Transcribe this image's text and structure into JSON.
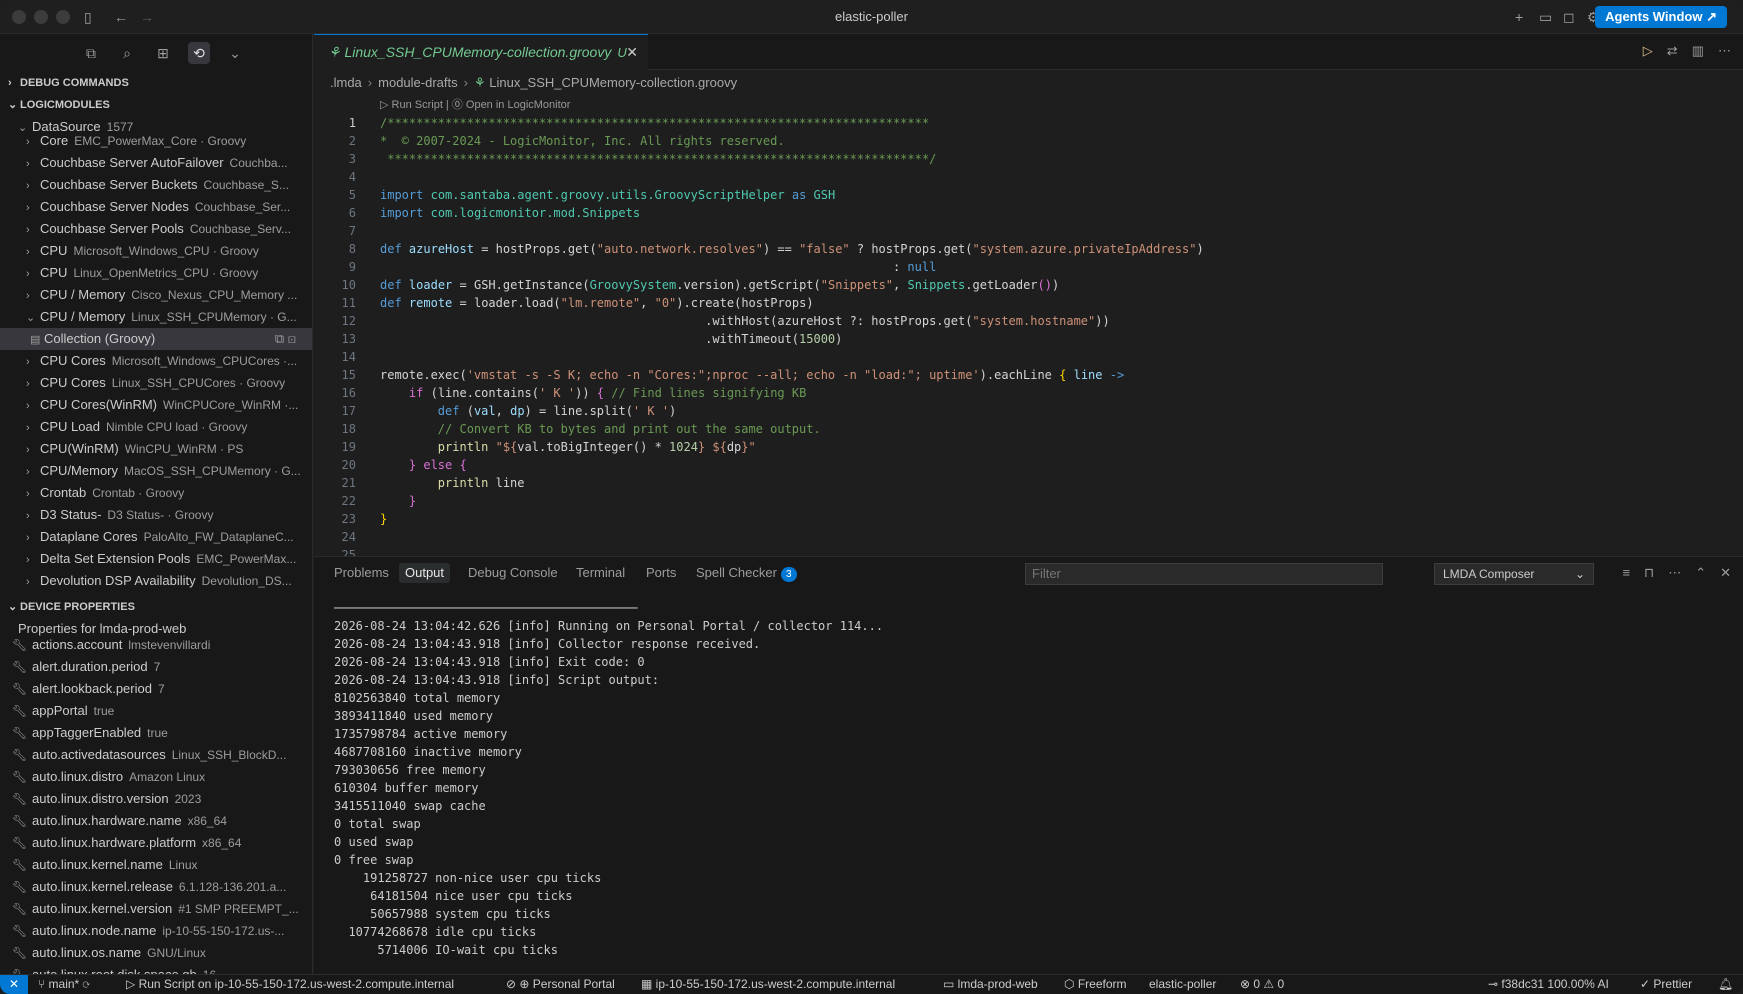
{
  "window": {
    "title": "elastic-poller",
    "agents_button": "Agents Window"
  },
  "sidebar": {
    "debug_commands": "DEBUG COMMANDS",
    "logicmodules": "LOGICMODULES",
    "datasource": {
      "label": "DataSource",
      "count": "1577"
    },
    "items": [
      {
        "label": "Core",
        "desc": "EMC_PowerMax_Core · Groovy",
        "expanded": false
      },
      {
        "label": "Couchbase Server AutoFailover",
        "desc": "Couchba...",
        "expanded": false
      },
      {
        "label": "Couchbase Server Buckets",
        "desc": "Couchbase_S...",
        "expanded": false
      },
      {
        "label": "Couchbase Server Nodes",
        "desc": "Couchbase_Ser...",
        "expanded": false
      },
      {
        "label": "Couchbase Server Pools",
        "desc": "Couchbase_Serv...",
        "expanded": false
      },
      {
        "label": "CPU",
        "desc": "Microsoft_Windows_CPU · Groovy",
        "expanded": false
      },
      {
        "label": "CPU",
        "desc": "Linux_OpenMetrics_CPU · Groovy",
        "expanded": false
      },
      {
        "label": "CPU / Memory",
        "desc": "Cisco_Nexus_CPU_Memory ...",
        "expanded": false
      },
      {
        "label": "CPU / Memory",
        "desc": "Linux_SSH_CPUMemory · G...",
        "expanded": true
      },
      {
        "label": "Collection (Groovy)",
        "desc": "",
        "child": true
      },
      {
        "label": "CPU Cores",
        "desc": "Microsoft_Windows_CPUCores ·...",
        "expanded": false
      },
      {
        "label": "CPU Cores",
        "desc": "Linux_SSH_CPUCores · Groovy",
        "expanded": false
      },
      {
        "label": "CPU Cores(WinRM)",
        "desc": "WinCPUCore_WinRM ·...",
        "expanded": false
      },
      {
        "label": "CPU Load",
        "desc": "Nimble CPU load · Groovy",
        "expanded": false
      },
      {
        "label": "CPU(WinRM)",
        "desc": "WinCPU_WinRM · PS",
        "expanded": false
      },
      {
        "label": "CPU/Memory",
        "desc": "MacOS_SSH_CPUMemory · G...",
        "expanded": false
      },
      {
        "label": "Crontab",
        "desc": "Crontab · Groovy",
        "expanded": false
      },
      {
        "label": "D3 Status-",
        "desc": "D3 Status- · Groovy",
        "expanded": false
      },
      {
        "label": "Dataplane Cores",
        "desc": "PaloAlto_FW_DataplaneC...",
        "expanded": false
      },
      {
        "label": "Delta Set Extension Pools",
        "desc": "EMC_PowerMax...",
        "expanded": false
      },
      {
        "label": "Devolution DSP Availability",
        "desc": "Devolution_DS...",
        "expanded": false
      }
    ],
    "device_properties": "DEVICE PROPERTIES",
    "properties_for": "Properties for lmda-prod-web",
    "properties": [
      {
        "key": "actions.account",
        "val": "lmstevenvillardi"
      },
      {
        "key": "alert.duration.period",
        "val": "7"
      },
      {
        "key": "alert.lookback.period",
        "val": "7"
      },
      {
        "key": "appPortal",
        "val": "true"
      },
      {
        "key": "appTaggerEnabled",
        "val": "true"
      },
      {
        "key": "auto.activedatasources",
        "val": "Linux_SSH_BlockD..."
      },
      {
        "key": "auto.linux.distro",
        "val": "Amazon Linux"
      },
      {
        "key": "auto.linux.distro.version",
        "val": "2023"
      },
      {
        "key": "auto.linux.hardware.name",
        "val": "x86_64"
      },
      {
        "key": "auto.linux.hardware.platform",
        "val": "x86_64"
      },
      {
        "key": "auto.linux.kernel.name",
        "val": "Linux"
      },
      {
        "key": "auto.linux.kernel.release",
        "val": "6.1.128-136.201.a..."
      },
      {
        "key": "auto.linux.kernel.version",
        "val": "#1 SMP PREEMPT_..."
      },
      {
        "key": "auto.linux.node.name",
        "val": "ip-10-55-150-172.us-..."
      },
      {
        "key": "auto.linux.os.name",
        "val": "GNU/Linux"
      },
      {
        "key": "auto.linux.root.disk.space.gb",
        "val": "16"
      }
    ]
  },
  "editor": {
    "tab_label": "Linux_SSH_CPUMemory-collection.groovy",
    "tab_status": "U",
    "breadcrumb": [
      ".lmda",
      "module-drafts",
      "Linux_SSH_CPUMemory-collection.groovy"
    ],
    "codelens": "▷ Run Script | ⓪ Open in LogicMonitor",
    "line_numbers": [
      "1",
      "2",
      "3",
      "4",
      "5",
      "6",
      "7",
      "8",
      "9",
      "10",
      "11",
      "12",
      "13",
      "14",
      "15",
      "16",
      "17",
      "18",
      "19",
      "20",
      "21",
      "22",
      "23",
      "24",
      "25"
    ]
  },
  "panel": {
    "tabs": [
      "Problems",
      "Output",
      "Debug Console",
      "Terminal",
      "Ports",
      "Spell Checker"
    ],
    "spell_badge": "3",
    "active_tab": "Output",
    "filter_placeholder": "Filter",
    "channel": "LMDA Composer",
    "output": [
      "──────────────────────────────────────────",
      "2026-08-24 13:04:42.626 [info] Running on Personal Portal / collector 114...",
      "2026-08-24 13:04:43.918 [info] Collector response received.",
      "2026-08-24 13:04:43.918 [info] Exit code: 0",
      "2026-08-24 13:04:43.918 [info] Script output:",
      "8102563840 total memory",
      "3893411840 used memory",
      "1735798784 active memory",
      "4687708160 inactive memory",
      "793030656 free memory",
      "610304 buffer memory",
      "3415511040 swap cache",
      "0 total swap",
      "0 used swap",
      "0 free swap",
      "    191258727 non-nice user cpu ticks",
      "     64181504 nice user cpu ticks",
      "     50657988 system cpu ticks",
      "  10774268678 idle cpu ticks",
      "      5714006 IO-wait cpu ticks"
    ]
  },
  "status": {
    "branch": "main*",
    "run_script": "Run Script on ip-10-55-150-172.us-west-2.compute.internal",
    "portal": "Personal Portal",
    "host": "ip-10-55-150-172.us-west-2.compute.internal",
    "device": "lmda-prod-web",
    "freeform": "Freeform",
    "project": "elastic-poller",
    "problems": "0",
    "warnings": "0",
    "commit": "f38dc31 100.00% AI",
    "formatter": "Prettier"
  }
}
